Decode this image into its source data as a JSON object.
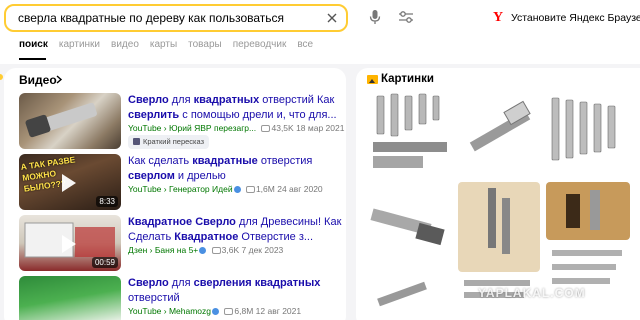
{
  "search": {
    "query": "сверла квадратные по дереву как пользоваться"
  },
  "header": {
    "browser_promo": "Установите Яндекс Браузер",
    "logo_letter": "Y"
  },
  "tabs": [
    {
      "label": "поиск",
      "active": true
    },
    {
      "label": "картинки",
      "active": false
    },
    {
      "label": "видео",
      "active": false
    },
    {
      "label": "карты",
      "active": false
    },
    {
      "label": "товары",
      "active": false
    },
    {
      "label": "переводчик",
      "active": false
    },
    {
      "label": "все",
      "active": false
    }
  ],
  "video_section": {
    "title": "Видео",
    "items": [
      {
        "title_parts": [
          {
            "t": "Сверло",
            "b": true
          },
          {
            "t": " для ",
            "b": false
          },
          {
            "t": "квадратных",
            "b": true
          },
          {
            "t": " отверстий Как ",
            "b": false
          },
          {
            "t": "сверлить",
            "b": true
          },
          {
            "t": " с помощью дрели и, что для...",
            "b": false
          }
        ],
        "source": "YouTube › Юрий ЯВР перезагр...",
        "views": "43,5K",
        "date": "18 мар 2021",
        "duration": "",
        "summary_button": "Краткий пересказ"
      },
      {
        "title_parts": [
          {
            "t": "Как сделать ",
            "b": false
          },
          {
            "t": "квадратные",
            "b": true
          },
          {
            "t": " отверстия ",
            "b": false
          },
          {
            "t": "сверлом",
            "b": true
          },
          {
            "t": " и дрелью",
            "b": false
          }
        ],
        "source": "YouTube › Генератор Идей",
        "views": "1,6M",
        "date": "24 авг 2020",
        "duration": "8:33",
        "thumb_text": "А ТАК РАЗВЕ МОЖНО БЫЛО???"
      },
      {
        "title_parts": [
          {
            "t": "Квадратное Сверло",
            "b": true
          },
          {
            "t": " для Древесины! Как Сделать ",
            "b": false
          },
          {
            "t": "Квадратное",
            "b": true
          },
          {
            "t": " Отверстие з...",
            "b": false
          }
        ],
        "source": "Дзен › Баня на 5+",
        "views": "3,6K",
        "date": "7 дек 2023",
        "duration": "00:59"
      },
      {
        "title_parts": [
          {
            "t": "Сверло",
            "b": true
          },
          {
            "t": " для ",
            "b": false
          },
          {
            "t": "сверления квадратных",
            "b": true
          },
          {
            "t": " отверстий",
            "b": false
          }
        ],
        "source": "YouTube › Mehamozg",
        "views": "6,8M",
        "date": "12 авг 2021",
        "duration": ""
      }
    ]
  },
  "images_section": {
    "title": "Картинки",
    "watermark": "YAPLAKAL.COM"
  },
  "colors": {
    "search_border": "#ffcc33",
    "link": "#1a0dab",
    "source": "#007700"
  }
}
